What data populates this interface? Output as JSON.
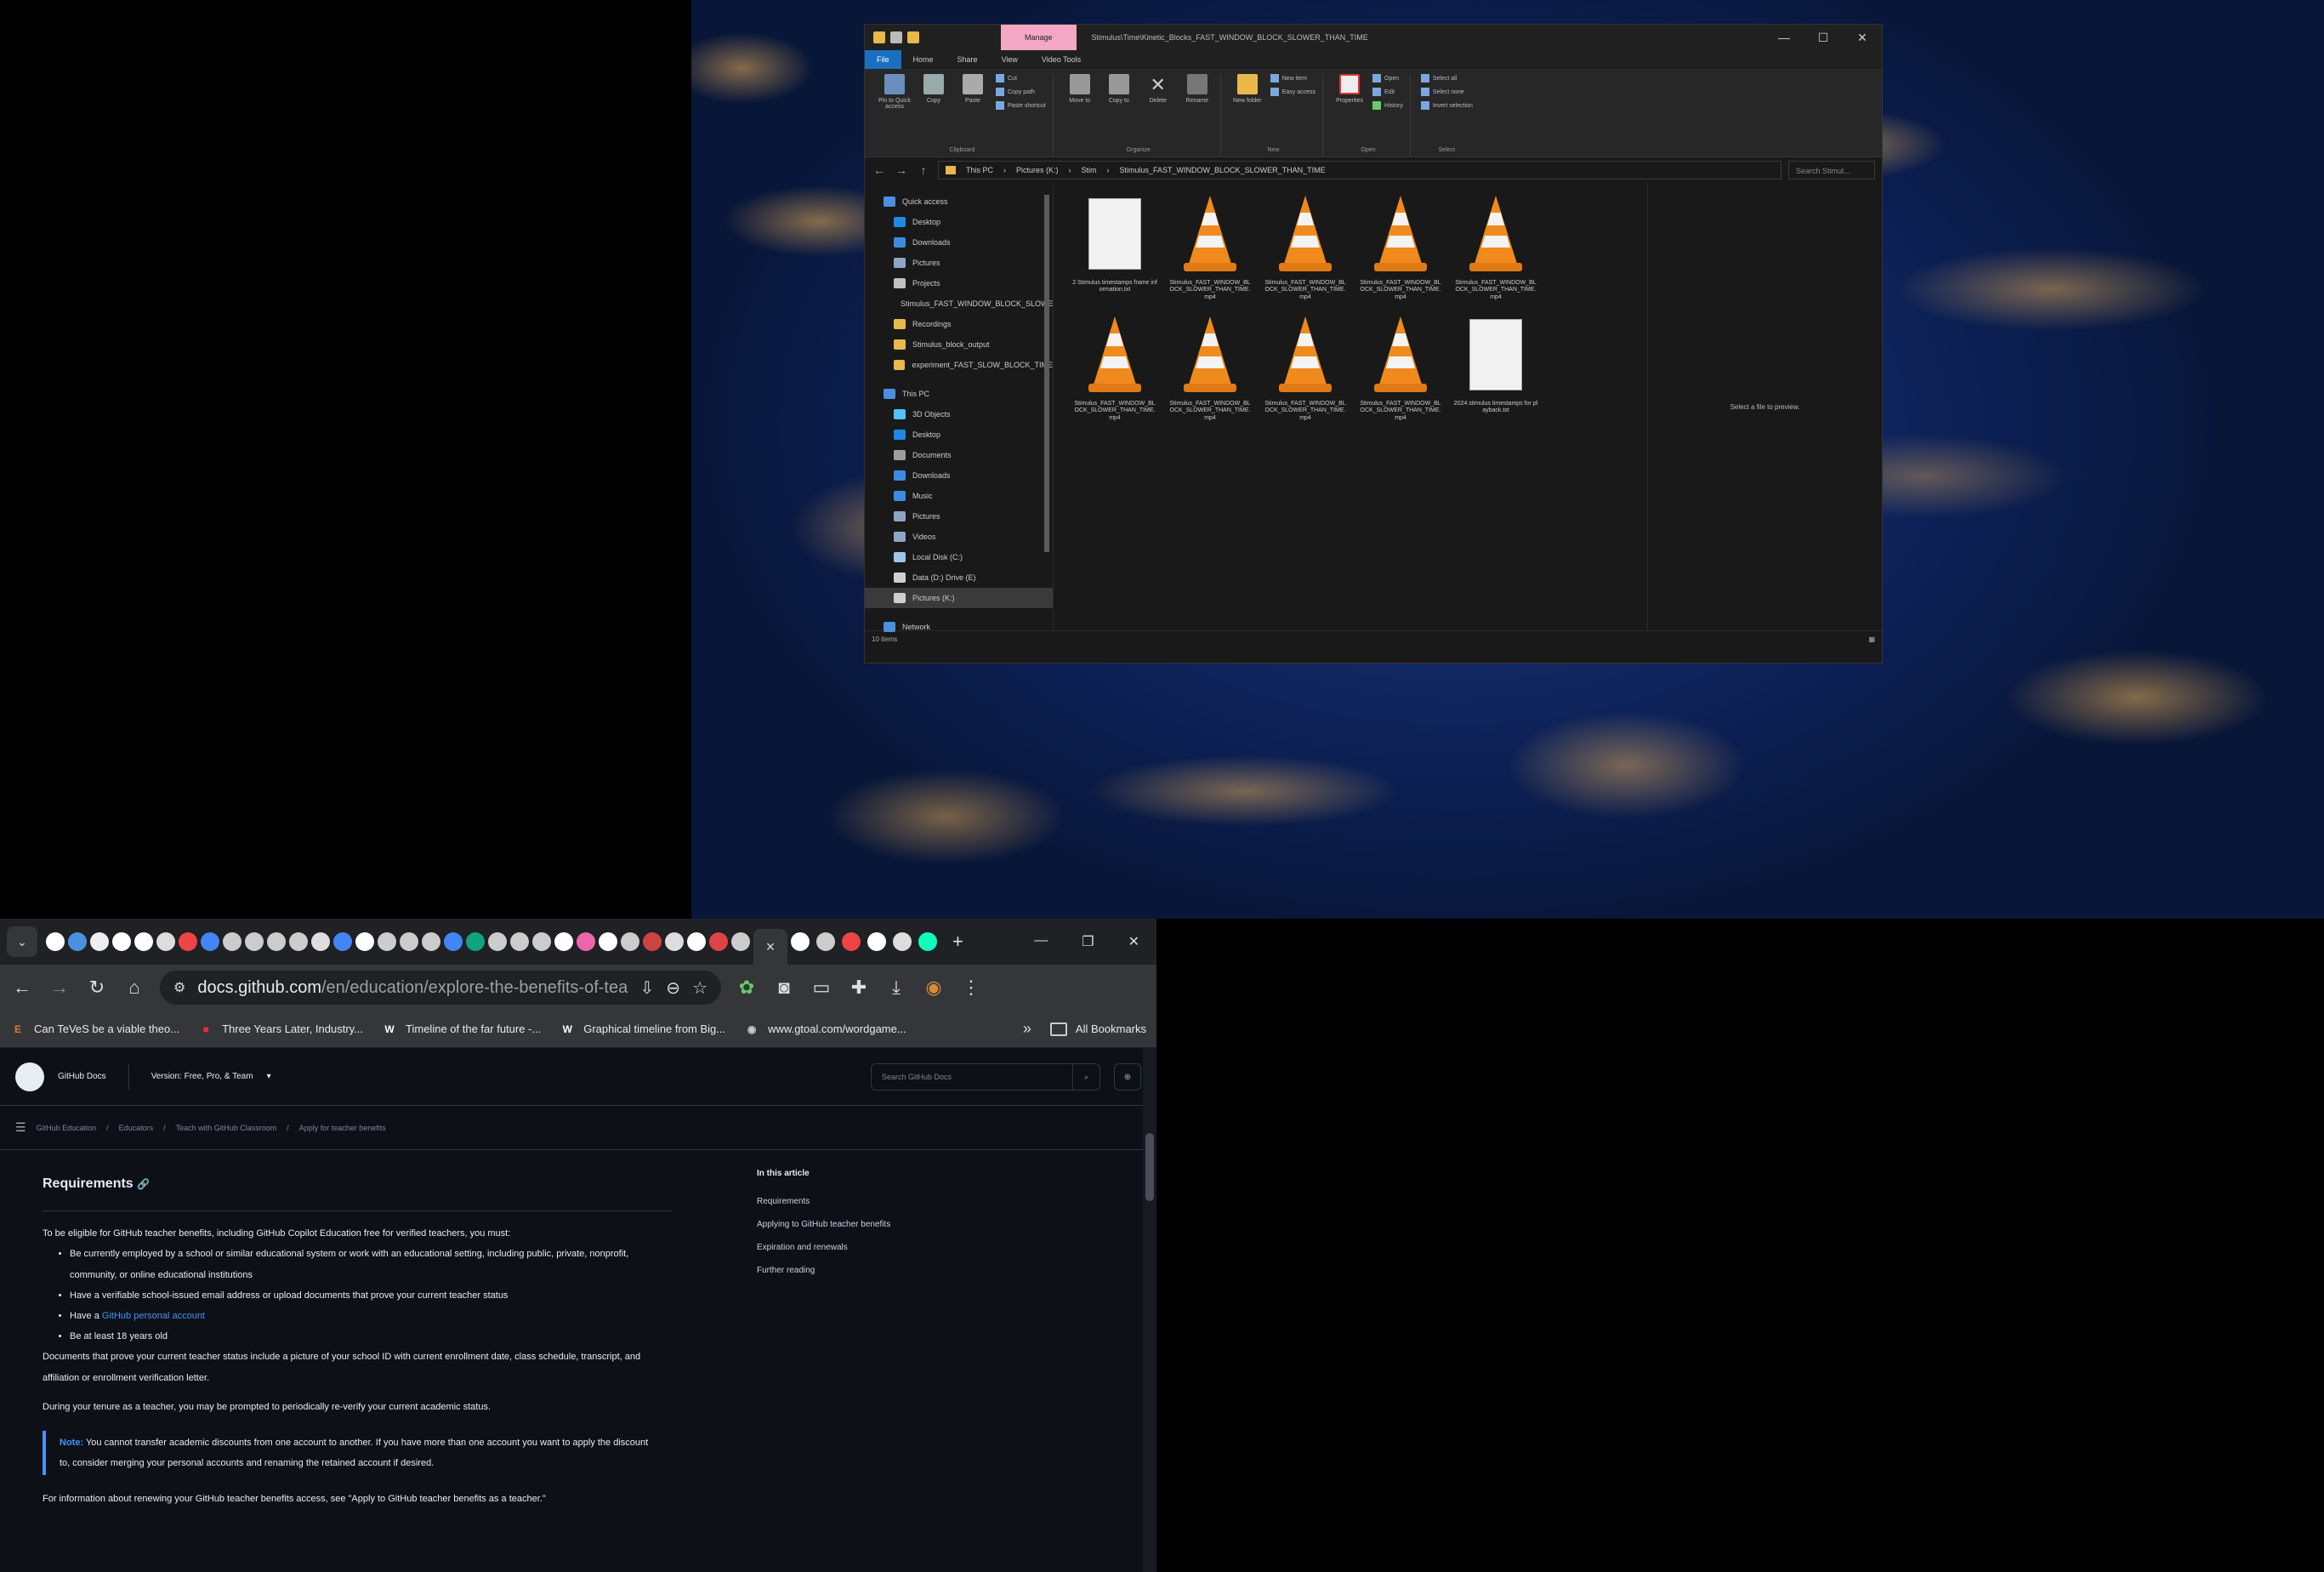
{
  "explorer": {
    "title_path": "Stimulus\\Time\\Kinetic_Blocks_FAST_WINDOW_BLOCK_SLOWER_THAN_TIME",
    "manage_tab": "Manage",
    "menu_tabs": [
      "File",
      "Home",
      "Share",
      "View",
      "Video Tools"
    ],
    "ribbon": {
      "clipboard": {
        "label": "Clipboard",
        "pin": "Pin to Quick access",
        "copy": "Copy",
        "paste": "Paste",
        "cut": "Cut",
        "copy_path": "Copy path",
        "paste_shortcut": "Paste shortcut"
      },
      "organize": {
        "label": "Organize",
        "move_to": "Move to",
        "copy_to": "Copy to",
        "delete": "Delete",
        "rename": "Rename"
      },
      "new": {
        "label": "New",
        "new_folder": "New folder",
        "new_item": "New item",
        "easy_access": "Easy access"
      },
      "open": {
        "label": "Open",
        "properties": "Properties",
        "open": "Open",
        "edit": "Edit",
        "history": "History"
      },
      "select": {
        "label": "Select",
        "select_all": "Select all",
        "select_none": "Select none",
        "invert": "Invert selection"
      }
    },
    "address": {
      "segments": [
        "This PC",
        "Pictures (K:)",
        "Stim",
        "Stimulus_FAST_WINDOW_BLOCK_SLOWER_THAN_TIME"
      ],
      "search_placeholder": "Search Stimul..."
    },
    "nav": [
      {
        "label": "Quick access",
        "color": "#4a90e2"
      },
      {
        "label": "Desktop",
        "color": "#1e88e5"
      },
      {
        "label": "Downloads",
        "color": "#3d8be0"
      },
      {
        "label": "Pictures",
        "color": "#8fa6c2"
      },
      {
        "label": "Projects",
        "color": "#c0c0c0"
      },
      {
        "label": "Stimulus_FAST_WINDOW_BLOCK_SLOWER",
        "color": "#e8b84a"
      },
      {
        "label": "Recordings",
        "color": "#e8b84a"
      },
      {
        "label": "Stimulus_block_output",
        "color": "#e8b84a"
      },
      {
        "label": "experiment_FAST_SLOW_BLOCK_TIME",
        "color": "#e8b84a"
      },
      {
        "label": "This PC",
        "color": "#4a90e2"
      },
      {
        "label": "3D Objects",
        "color": "#4fc3f7"
      },
      {
        "label": "Desktop",
        "color": "#1e88e5"
      },
      {
        "label": "Documents",
        "color": "#9e9e9e"
      },
      {
        "label": "Downloads",
        "color": "#3d8be0"
      },
      {
        "label": "Music",
        "color": "#3d8be0"
      },
      {
        "label": "Pictures",
        "color": "#8fa6c2"
      },
      {
        "label": "Videos",
        "color": "#8fa6c2"
      },
      {
        "label": "Local Disk (C:)",
        "color": "#9ec5e8"
      },
      {
        "label": "Data (D:) Drive (E)",
        "color": "#cfcfcf"
      },
      {
        "label": "Pictures (K:)",
        "color": "#cfcfcf"
      },
      {
        "label": "Network",
        "color": "#4a90e2"
      }
    ],
    "files": [
      {
        "name": "2 Stimulus timestamps frame information.txt",
        "kind": "doc"
      },
      {
        "name": "Stimulus_FAST_WINDOW_BLOCK_SLOWER_THAN_TIME.mp4",
        "kind": "vlc"
      },
      {
        "name": "Stimulus_FAST_WINDOW_BLOCK_SLOWER_THAN_TIME.mp4",
        "kind": "vlc"
      },
      {
        "name": "Stimulus_FAST_WINDOW_BLOCK_SLOWER_THAN_TIME.mp4",
        "kind": "vlc"
      },
      {
        "name": "Stimulus_FAST_WINDOW_BLOCK_SLOWER_THAN_TIME.mp4",
        "kind": "vlc"
      },
      {
        "name": "Stimulus_FAST_WINDOW_BLOCK_SLOWER_THAN_TIME.mp4",
        "kind": "vlc"
      },
      {
        "name": "Stimulus_FAST_WINDOW_BLOCK_SLOWER_THAN_TIME.mp4",
        "kind": "vlc"
      },
      {
        "name": "Stimulus_FAST_WINDOW_BLOCK_SLOWER_THAN_TIME.mp4",
        "kind": "vlc"
      },
      {
        "name": "Stimulus_FAST_WINDOW_BLOCK_SLOWER_THAN_TIME.mp4",
        "kind": "vlc"
      },
      {
        "name": "2024 stimulus timestamps for playback.txt",
        "kind": "doc"
      }
    ],
    "preview_text": "Select a file to preview.",
    "status_items": "10 items"
  },
  "browser": {
    "active_tab_close": "×",
    "new_tab": "+",
    "url_host": "docs.github.com",
    "url_path": "/en/education/explore-the-benefits-of-teachin...",
    "bookmarks": [
      {
        "label": "Can TeVeS be a viable theo...",
        "icon": "E",
        "color": "#e07a2f"
      },
      {
        "label": "Three Years Later, Industry...",
        "icon": "■",
        "color": "#d33"
      },
      {
        "label": "Timeline of the far future -...",
        "icon": "W",
        "color": "#fff"
      },
      {
        "label": "Graphical timeline from Big...",
        "icon": "W",
        "color": "#fff"
      },
      {
        "label": "www.gtoal.com/wordgame...",
        "icon": "◉",
        "color": "#ccc"
      }
    ],
    "bookmarks_overflow": "»",
    "all_bookmarks": "All Bookmarks"
  },
  "docs": {
    "brand": "GitHub Docs",
    "version": "Version: Free, Pro, & Team",
    "search_placeholder": "Search GitHub Docs",
    "breadcrumbs": [
      "GitHub Education",
      "Educators",
      "Teach with GitHub Classroom",
      "Apply for teacher benefits"
    ],
    "heading": "Requirements",
    "intro": "To be eligible for GitHub teacher benefits, including GitHub Copilot Education free for verified teachers, you must:",
    "bullets": [
      "Be currently employed by a school or similar educational system or work with an educational setting, including public, private, nonprofit, community, or online educational institutions",
      "Have a verifiable school-issued email address or upload documents that prove your current teacher status",
      "Have a GitHub personal account",
      "Be at least 18 years old"
    ],
    "bullet_link": "GitHub personal account",
    "para1": "Documents that prove your current teacher status include a picture of your school ID with current enrollment date, class schedule, transcript, and affiliation or enrollment verification letter.",
    "para2": "During your tenure as a teacher, you may be prompted to periodically re-verify your current academic status.",
    "note_label": "Note:",
    "note_text": "You cannot transfer academic discounts from one account to another. If you have more than one account you want to apply the discount to, consider merging your personal accounts and renaming the retained account if desired.",
    "para3": "For information about renewing your GitHub teacher benefits access, see \"Apply to GitHub teacher benefits as a teacher.\"",
    "toc_title": "In this article",
    "toc": [
      "Requirements",
      "Applying to GitHub teacher benefits",
      "Expiration and renewals",
      "Further reading"
    ]
  }
}
